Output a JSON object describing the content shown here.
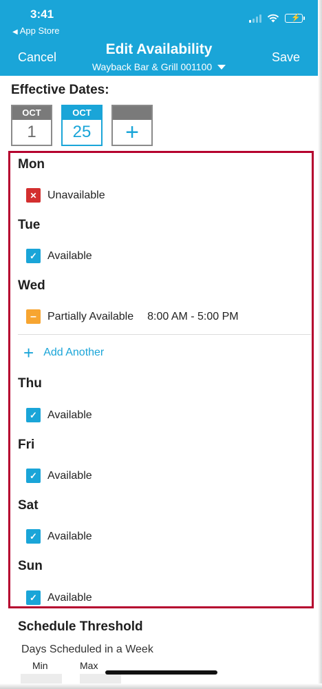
{
  "status_bar": {
    "time": "3:41",
    "back_label": "App Store",
    "back_icon": "triangle-left-icon",
    "signal_icon": "cellular-signal-icon",
    "wifi_icon": "wifi-icon",
    "battery_icon": "battery-charging-icon"
  },
  "header": {
    "cancel_label": "Cancel",
    "title": "Edit Availability",
    "subtitle": "Wayback Bar & Grill 001100",
    "save_label": "Save",
    "color": "#1aa5d8"
  },
  "effective_dates": {
    "label": "Effective Dates:",
    "dates": [
      {
        "month": "OCT",
        "day": "1",
        "selected": false
      },
      {
        "month": "OCT",
        "day": "25",
        "selected": true
      }
    ],
    "add_label": "+"
  },
  "days": [
    {
      "name": "Mon",
      "status": "Unavailable",
      "status_type": "unavailable",
      "icon": "x-icon",
      "glyph": "✕"
    },
    {
      "name": "Tue",
      "status": "Available",
      "status_type": "available",
      "icon": "check-icon",
      "glyph": "✓"
    },
    {
      "name": "Wed",
      "status": "Partially Available",
      "status_type": "partial",
      "icon": "minus-icon",
      "glyph": "–",
      "time": "8:00 AM - 5:00 PM"
    },
    {
      "name": "Thu",
      "status": "Available",
      "status_type": "available",
      "icon": "check-icon",
      "glyph": "✓"
    },
    {
      "name": "Fri",
      "status": "Available",
      "status_type": "available",
      "icon": "check-icon",
      "glyph": "✓"
    },
    {
      "name": "Sat",
      "status": "Available",
      "status_type": "available",
      "icon": "check-icon",
      "glyph": "✓"
    },
    {
      "name": "Sun",
      "status": "Available",
      "status_type": "available",
      "icon": "check-icon",
      "glyph": "✓"
    }
  ],
  "add_another": {
    "label": "Add Another",
    "icon": "plus-icon"
  },
  "schedule_threshold": {
    "title": "Schedule Threshold",
    "subtitle": "Days Scheduled in a Week",
    "min_label": "Min",
    "max_label": "Max"
  },
  "colors": {
    "highlight": "#b5002e",
    "available": "#1aa5d8",
    "unavailable": "#d32f2f",
    "partial": "#f7a531"
  }
}
